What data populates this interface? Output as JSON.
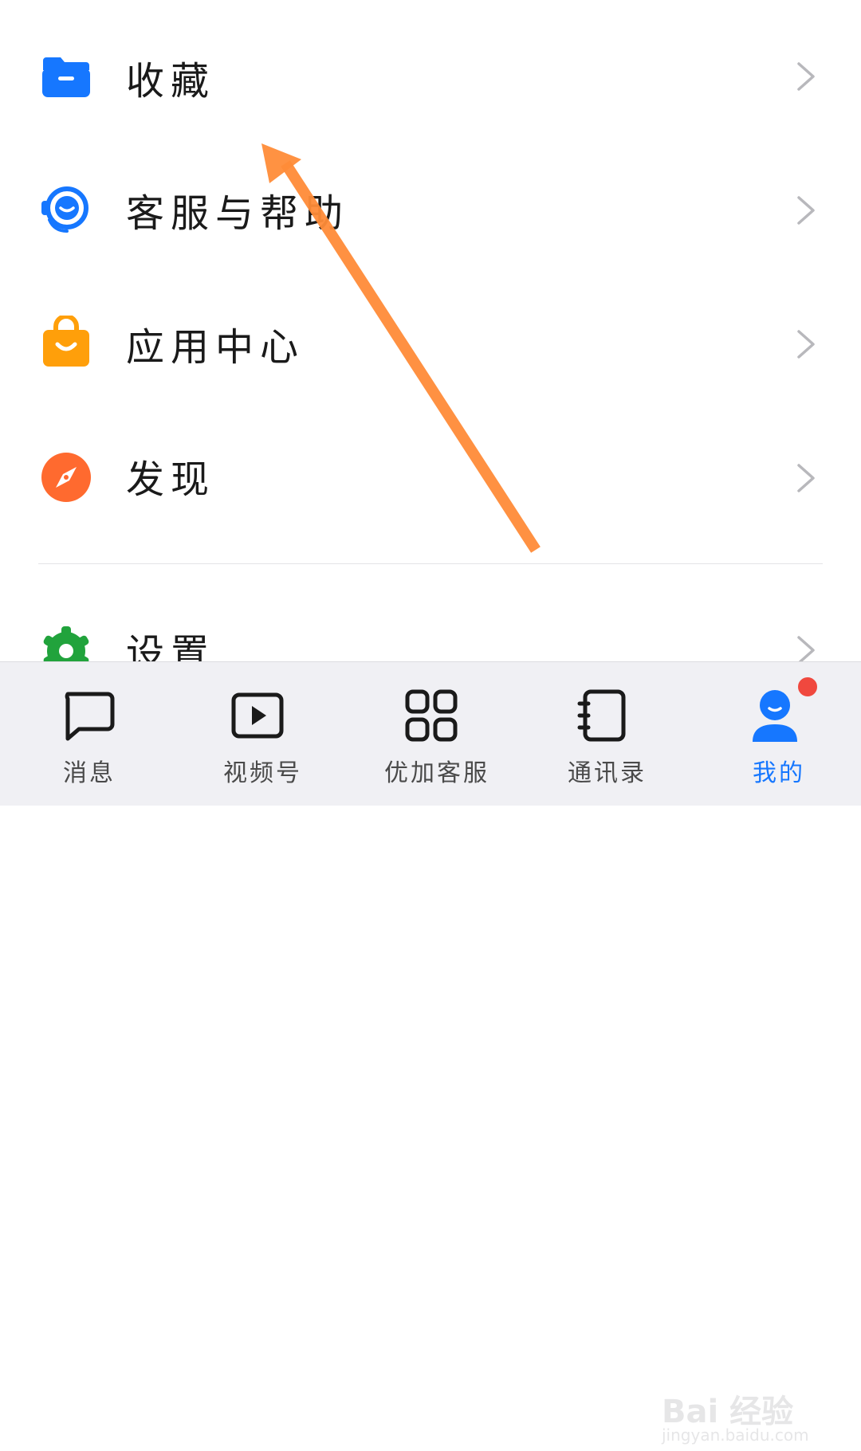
{
  "menu": {
    "items": [
      {
        "label": "收藏",
        "icon": "folder-icon",
        "color": "#1677ff"
      },
      {
        "label": "客服与帮助",
        "icon": "headset-icon",
        "color": "#1677ff"
      },
      {
        "label": "应用中心",
        "icon": "shopping-bag-icon",
        "color": "#ff9f0a"
      },
      {
        "label": "发现",
        "icon": "compass-icon",
        "color": "#ff6a2f"
      },
      {
        "label": "设置",
        "icon": "gear-icon",
        "color": "#21a33c"
      }
    ]
  },
  "tabbar": {
    "tabs": [
      {
        "label": "消息",
        "icon": "chat-bubble-icon"
      },
      {
        "label": "视频号",
        "icon": "video-play-icon"
      },
      {
        "label": "优加客服",
        "icon": "apps-grid-icon"
      },
      {
        "label": "通讯录",
        "icon": "contacts-book-icon"
      },
      {
        "label": "我的",
        "icon": "user-profile-icon",
        "active": true
      }
    ],
    "active_color": "#1677ff",
    "badge_color": "#f0483e"
  },
  "annotation": {
    "icon": "arrow-annotation",
    "color": "#ff8c38"
  },
  "watermark": {
    "brand": "Bai 经验",
    "site": "jingyan.baidu.com"
  }
}
